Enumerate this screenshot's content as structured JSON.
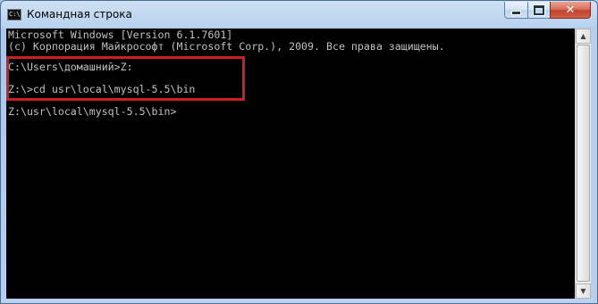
{
  "window": {
    "title": "Командная строка",
    "app_icon_text": "C:\\",
    "minimize_label": "",
    "maximize_label": "",
    "close_label": "✕"
  },
  "console": {
    "lines": [
      "Microsoft Windows [Version 6.1.7601]",
      "(c) Корпорация Майкрософт (Microsoft Corp.), 2009. Все права защищены.",
      "",
      "C:\\Users\\домашний>Z:",
      "",
      "Z:\\>cd usr\\local\\mysql-5.5\\bin",
      "",
      "Z:\\usr\\local\\mysql-5.5\\bin>"
    ]
  },
  "scrollbar": {
    "up_glyph": "▲",
    "down_glyph": "▼"
  },
  "colors": {
    "console_background": "#000000",
    "console_text": "#c0c0c0",
    "highlight_border": "#cc1f1f"
  }
}
